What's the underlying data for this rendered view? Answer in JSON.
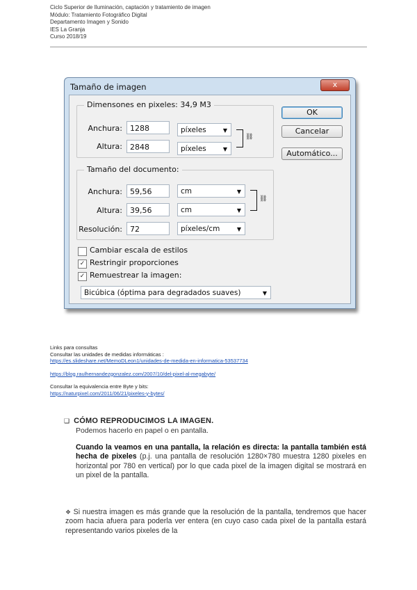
{
  "header": {
    "lines": [
      "Ciclo Superior de Iluminación, captación y tratamiento de imagen",
      "Módulo: Tratamiento Fotográfico Digital",
      "Departamento Imagen y Sonido",
      "IES La Granja",
      "Curso 2018/19"
    ]
  },
  "dialog": {
    "title": "Tamaño de imagen",
    "close_label": "x",
    "pixel_group": {
      "label": "Dimensones en pixeles: 34,9 M3",
      "width_label": "Anchura:",
      "width_value": "1288",
      "width_unit": "píxeles",
      "height_label": "Altura:",
      "height_value": "2848",
      "height_unit": "píxeles"
    },
    "doc_group": {
      "label": "Tamaño del documento:",
      "width_label": "Anchura:",
      "width_value": "59,56",
      "width_unit": "cm",
      "height_label": "Altura:",
      "height_value": "39,56",
      "height_unit": "cm",
      "res_label": "Resolución:",
      "res_value": "72",
      "res_unit": "píxeles/cm"
    },
    "buttons": {
      "ok": "OK",
      "cancel": "Cancelar",
      "auto": "Automático..."
    },
    "checks": {
      "scale_styles": "Cambiar escala de estilos",
      "constrain": "Restringir proporciones",
      "resample": "Remuestrear la imagen:"
    },
    "resample_method": "Bicúbica (óptima para degradados suaves)"
  },
  "links": {
    "title": "Links para consultas",
    "units_intro": "Consultar las unidades de medidas informáticas :",
    "link1": "https://es.slideshare.net/MemoDLeon1/unidades-de-medida-en-informatica-53537734",
    "link2": "https://blog.raulhernandezgonzalez.com/2007/10/del-pixel-al-megabyte/",
    "byte_intro": "Consultar la equivalencia entre Byte y bits:",
    "link3": "https://naturpixel.com/2011/06/21/pixeles-y-bytes/"
  },
  "section": {
    "heading": "CÓMO REPRODUCIMOS LA IMAGEN.",
    "subline": "Podemos hacerlo en papel o en pantalla.",
    "para1_bold": "Cuando la veamos en una pantalla, la relación es directa: la pantalla también está hecha de pixeles",
    "para1_rest": " (p.j. una pantalla de resolución 1280×780 muestra 1280 pixeles en horizontal por 780 en vertical) por lo que cada pixel de la imagen digital se mostrará en un pixel de la pantalla.",
    "para2": "Si nuestra imagen es más grande que la resolución de la pantalla, tendremos que hacer zoom hacia afuera para poderla ver entera (en cuyo caso cada pixel de la pantalla estará representando varios pixeles de la"
  }
}
